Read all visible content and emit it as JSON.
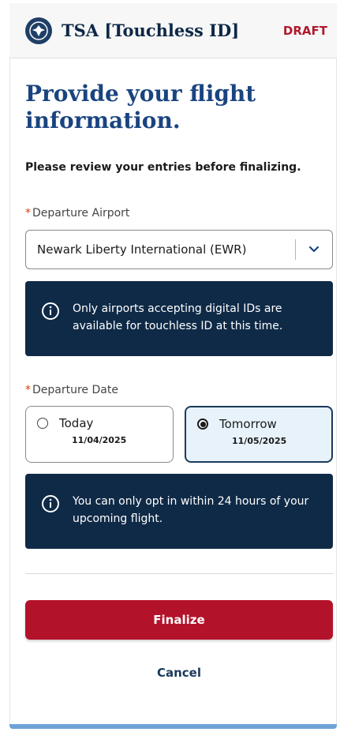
{
  "header": {
    "title": "TSA [Touchless ID]",
    "status_badge": "DRAFT",
    "logo_icon": "tsa-seal-icon"
  },
  "page": {
    "title": "Provide your flight information.",
    "review_instruction": "Please review your entries before finalizing."
  },
  "departure_airport": {
    "required_marker": "*",
    "label": "Departure Airport",
    "selected_value": "Newark Liberty International (EWR)",
    "dropdown_icon": "chevron-down-icon",
    "notice": "Only airports accepting digital IDs are available for touchless ID at this time."
  },
  "departure_date": {
    "required_marker": "*",
    "label": "Departure Date",
    "options": [
      {
        "label": "Today",
        "date": "11/04/2025",
        "selected": false
      },
      {
        "label": "Tomorrow",
        "date": "11/05/2025",
        "selected": true
      }
    ],
    "notice": "You can only opt in within 24 hours of your upcoming flight."
  },
  "actions": {
    "finalize_label": "Finalize",
    "cancel_label": "Cancel"
  },
  "colors": {
    "primary_navy": "#0f2a47",
    "title_blue": "#1a4480",
    "finalize_red": "#b3122b",
    "draft_red": "#b01a2e",
    "selected_bg": "#e7f2fb"
  }
}
